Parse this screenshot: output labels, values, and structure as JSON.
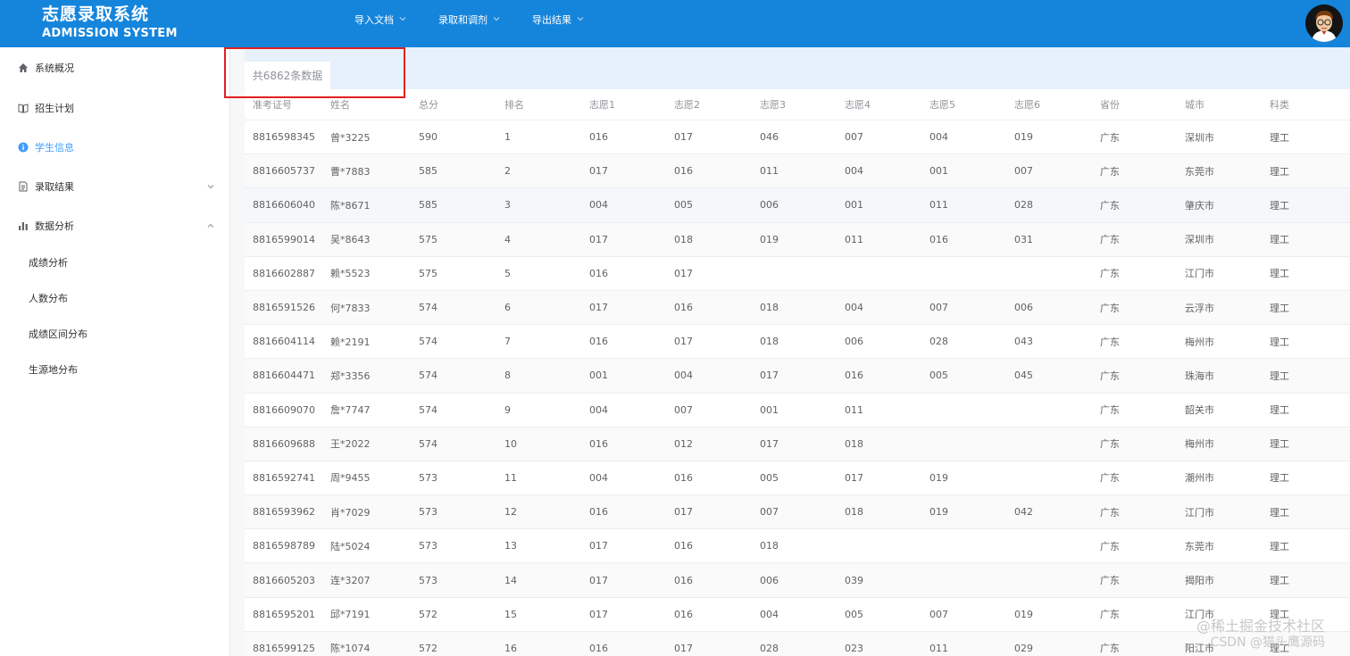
{
  "header": {
    "title": "志愿录取系统",
    "subtitle": "ADMISSION SYSTEM",
    "nav": [
      {
        "label": "导入文档"
      },
      {
        "label": "录取和调剂"
      },
      {
        "label": "导出结果"
      }
    ],
    "brand_color": "#1585dc"
  },
  "sidebar": {
    "items": [
      {
        "label": "系统概况",
        "icon": "home-icon"
      },
      {
        "label": "招生计划",
        "icon": "book-icon"
      },
      {
        "label": "学生信息",
        "icon": "info-icon",
        "active": true
      },
      {
        "label": "录取结果",
        "icon": "document-icon",
        "arrow": "chevron-down"
      },
      {
        "label": "数据分析",
        "icon": "bar-chart-icon",
        "arrow": "chevron-up"
      }
    ],
    "subitems": [
      "成绩分析",
      "人数分布",
      "成绩区间分布",
      "生源地分布"
    ],
    "active_color": "#409eff"
  },
  "tab": {
    "label": "共6862条数据"
  },
  "table": {
    "headers": [
      "准考证号",
      "姓名",
      "总分",
      "排名",
      "志愿1",
      "志愿2",
      "志愿3",
      "志愿4",
      "志愿5",
      "志愿6",
      "省份",
      "城市",
      "科类"
    ],
    "rows": [
      [
        "8816598345",
        "曾*3225",
        "590",
        "1",
        "016",
        "017",
        "046",
        "007",
        "004",
        "019",
        "广东",
        "深圳市",
        "理工"
      ],
      [
        "8816605737",
        "曹*7883",
        "585",
        "2",
        "017",
        "016",
        "011",
        "004",
        "001",
        "007",
        "广东",
        "东莞市",
        "理工"
      ],
      [
        "8816606040",
        "陈*8671",
        "585",
        "3",
        "004",
        "005",
        "006",
        "001",
        "011",
        "028",
        "广东",
        "肇庆市",
        "理工"
      ],
      [
        "8816599014",
        "吴*8643",
        "575",
        "4",
        "017",
        "018",
        "019",
        "011",
        "016",
        "031",
        "广东",
        "深圳市",
        "理工"
      ],
      [
        "8816602887",
        "赖*5523",
        "575",
        "5",
        "016",
        "017",
        "",
        "",
        "",
        "",
        "广东",
        "江门市",
        "理工"
      ],
      [
        "8816591526",
        "何*7833",
        "574",
        "6",
        "017",
        "016",
        "018",
        "004",
        "007",
        "006",
        "广东",
        "云浮市",
        "理工"
      ],
      [
        "8816604114",
        "赖*2191",
        "574",
        "7",
        "016",
        "017",
        "018",
        "006",
        "028",
        "043",
        "广东",
        "梅州市",
        "理工"
      ],
      [
        "8816604471",
        "郑*3356",
        "574",
        "8",
        "001",
        "004",
        "017",
        "016",
        "005",
        "045",
        "广东",
        "珠海市",
        "理工"
      ],
      [
        "8816609070",
        "詹*7747",
        "574",
        "9",
        "004",
        "007",
        "001",
        "011",
        "",
        "",
        "广东",
        "韶关市",
        "理工"
      ],
      [
        "8816609688",
        "王*2022",
        "574",
        "10",
        "016",
        "012",
        "017",
        "018",
        "",
        "",
        "广东",
        "梅州市",
        "理工"
      ],
      [
        "8816592741",
        "周*9455",
        "573",
        "11",
        "004",
        "016",
        "005",
        "017",
        "019",
        "",
        "广东",
        "潮州市",
        "理工"
      ],
      [
        "8816593962",
        "肖*7029",
        "573",
        "12",
        "016",
        "017",
        "007",
        "018",
        "019",
        "042",
        "广东",
        "江门市",
        "理工"
      ],
      [
        "8816598789",
        "陆*5024",
        "573",
        "13",
        "017",
        "016",
        "018",
        "",
        "",
        "",
        "广东",
        "东莞市",
        "理工"
      ],
      [
        "8816605203",
        "连*3207",
        "573",
        "14",
        "017",
        "016",
        "006",
        "039",
        "",
        "",
        "广东",
        "揭阳市",
        "理工"
      ],
      [
        "8816595201",
        "邱*7191",
        "572",
        "15",
        "017",
        "016",
        "004",
        "005",
        "007",
        "019",
        "广东",
        "江门市",
        "理工"
      ],
      [
        "8816599125",
        "陈*1074",
        "572",
        "16",
        "016",
        "017",
        "028",
        "023",
        "011",
        "029",
        "广东",
        "阳江市",
        "理工"
      ]
    ]
  },
  "watermark": {
    "line1": "@稀土掘金技术社区",
    "line2": "CSDN @猫头鹰源码"
  }
}
